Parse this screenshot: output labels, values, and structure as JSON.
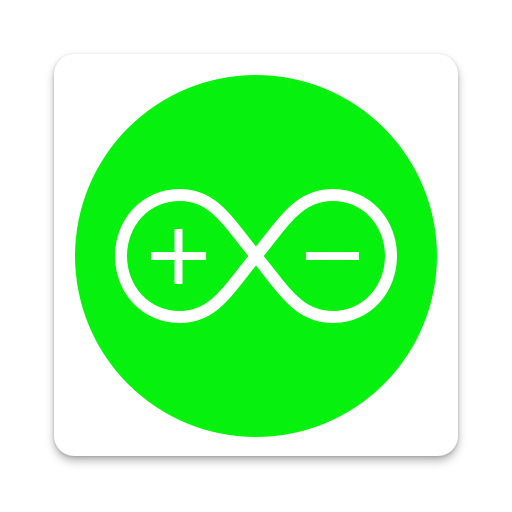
{
  "app_icon": {
    "icon": "infinity-plus-minus-icon",
    "colors": {
      "tile": "#ffffff",
      "circle": "#06f10e",
      "symbol": "#ffffff"
    }
  }
}
